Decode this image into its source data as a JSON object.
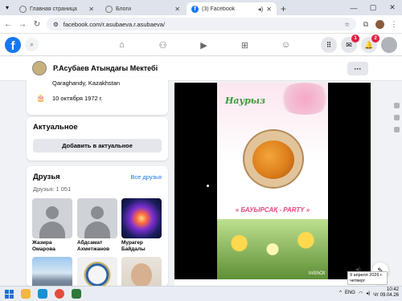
{
  "browser": {
    "tabs": [
      {
        "title": "Главная страница",
        "active": false
      },
      {
        "title": "Блоги",
        "active": false
      },
      {
        "title": "(3) Facebook",
        "active": true
      }
    ],
    "url": "facebook.com/r.asubaeva.r.asubaeva/",
    "window_controls": [
      "—",
      "▢",
      "✕"
    ]
  },
  "facebook": {
    "logo": "f",
    "nav_icons": [
      "home-icon",
      "friends-icon",
      "watch-icon",
      "marketplace-icon",
      "groups-icon"
    ],
    "badges": {
      "messenger": "1",
      "notifications": "2"
    },
    "brand_color": "#1877f2"
  },
  "profile": {
    "name": "Р.Асубаев Атындағы Мектебі",
    "more": "···"
  },
  "intro": {
    "location": "Qaraghandy, Kazakhstan",
    "birthday": "10 октября 1972 г."
  },
  "actual": {
    "heading": "Актуальное",
    "add_button": "Добавить в актуальное"
  },
  "friends": {
    "heading": "Друзья",
    "see_all": "Все друзья",
    "count": "Друзья: 1 051",
    "items": [
      {
        "name": "Жазира Омарова"
      },
      {
        "name": "Абдсамат Ахметжанов"
      },
      {
        "name": "Мурагер Байдалы"
      },
      {
        "name": ""
      },
      {
        "name": ""
      },
      {
        "name": ""
      }
    ]
  },
  "post": {
    "title_text": "Наурыз",
    "party_text": "« БАУЫРСАҚ - PARTY »",
    "watermark": "InShOt"
  },
  "tooltip": {
    "line1": "9 апреля 2026 г.",
    "line2": "четверг"
  },
  "taskbar": {
    "lang": "ENG",
    "time": "10:42",
    "date": "Чт 09.04.26"
  }
}
